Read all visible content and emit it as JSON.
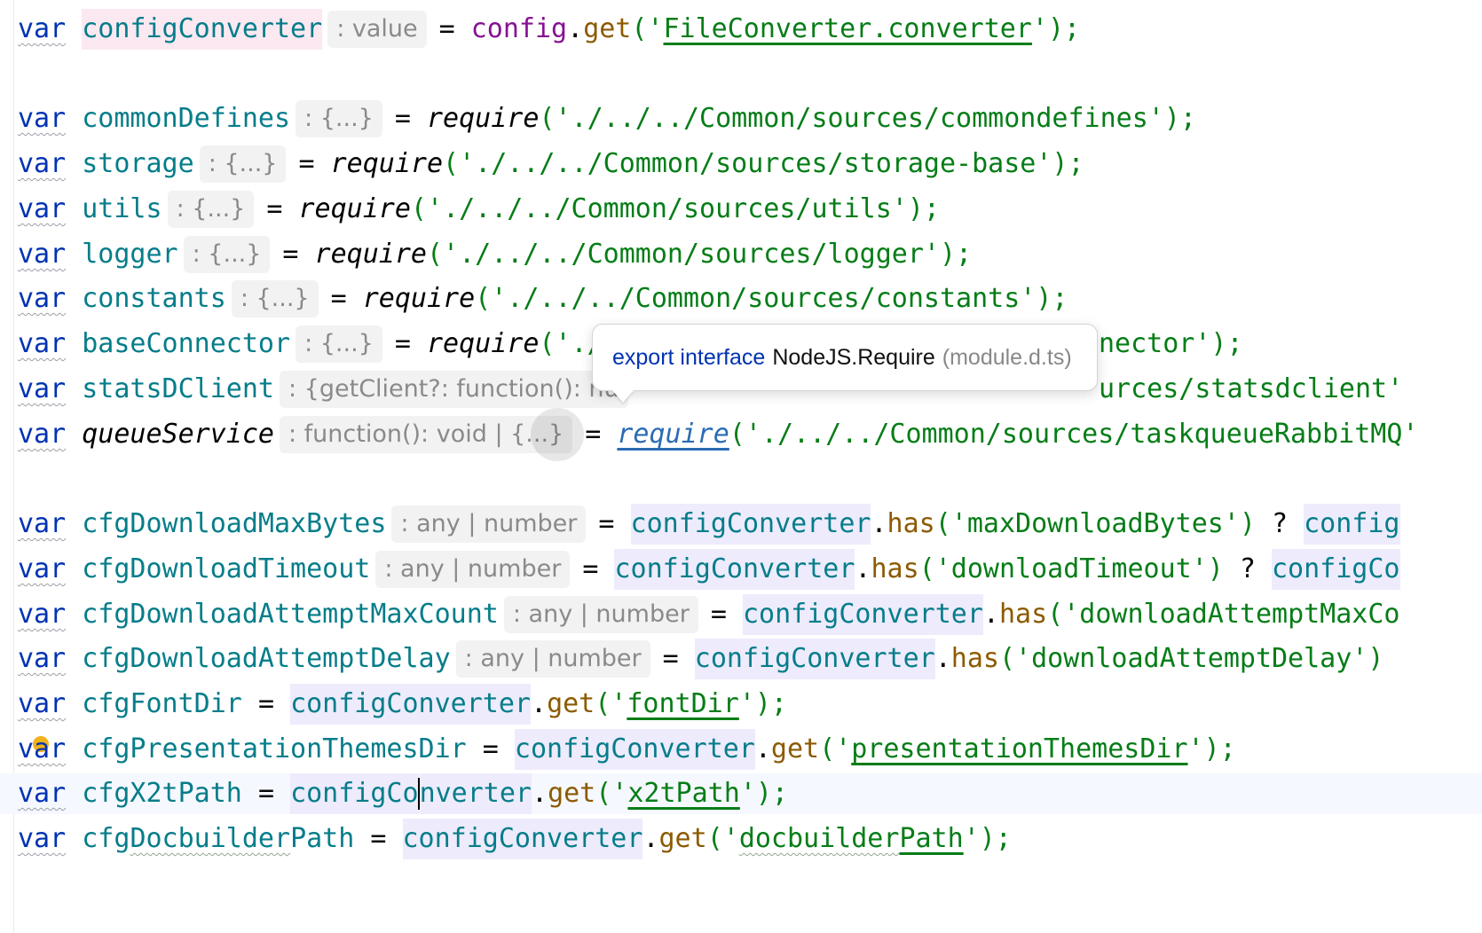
{
  "editor": {
    "lines": {
      "configConverter": {
        "kw": "var",
        "name": "configConverter",
        "hint": ": value",
        "eq": "=",
        "obj": "config",
        "dot": ".",
        "method": "get",
        "open": "('",
        "arg": "FileConverter.converter",
        "close": "');"
      },
      "commonDefines": {
        "kw": "var",
        "name": "commonDefines",
        "hint": ": {...}",
        "eq": "=",
        "fn": "require",
        "arg": "('./../../Common/sources/commondefines');"
      },
      "storage": {
        "kw": "var",
        "name": "storage",
        "hint": ": {...}",
        "eq": "=",
        "fn": "require",
        "arg": "('./../../Common/sources/storage-base');"
      },
      "utils": {
        "kw": "var",
        "name": "utils",
        "hint": ": {...}",
        "eq": "=",
        "fn": "require",
        "arg": "('./../../Common/sources/utils');"
      },
      "logger": {
        "kw": "var",
        "name": "logger",
        "hint": ": {...}",
        "eq": "=",
        "fn": "require",
        "arg": "('./../../Common/sources/logger');"
      },
      "constants": {
        "kw": "var",
        "name": "constants",
        "hint": ": {...}",
        "eq": "=",
        "fn": "require",
        "arg": "('./../../Common/sources/constants');"
      },
      "baseConnector": {
        "kw": "var",
        "name": "baseConnector",
        "hint": ": {...}",
        "eq": "=",
        "fn": "require",
        "arg": "('./",
        "tail": "nector');"
      },
      "statsDClient": {
        "kw": "var",
        "name": "statsDClient",
        "hint": ": {getClient?: function(): nu",
        "tail": "urces/statsdclient'"
      },
      "queueService": {
        "kw": "var",
        "name": "queueService",
        "hint": ": function(): void | {...}",
        "eq": "=",
        "fn": "require",
        "arg": "('./../../Common/sources/taskqueueRabbitMQ'"
      },
      "cfgDownloadMaxBytes": {
        "kw": "var",
        "name": "cfgDownloadMaxBytes",
        "hint": ": any | number",
        "eq": "=",
        "ref": "configConverter",
        "dot": ".",
        "method": "has",
        "arg": "('maxDownloadBytes')",
        "rest": " ? ",
        "ref2": "config"
      },
      "cfgDownloadTimeout": {
        "kw": "var",
        "name": "cfgDownloadTimeout",
        "hint": ": any | number",
        "eq": "=",
        "ref": "configConverter",
        "dot": ".",
        "method": "has",
        "arg": "('downloadTimeout')",
        "rest": " ? ",
        "ref2": "configCo"
      },
      "cfgDownloadAttemptMaxCount": {
        "kw": "var",
        "name": "cfgDownloadAttemptMaxCount",
        "hint": ": any | number",
        "eq": "=",
        "ref": "configConverter",
        "dot": ".",
        "method": "has",
        "arg": "('downloadAttemptMaxCo"
      },
      "cfgDownloadAttemptDelay": {
        "kw": "var",
        "name": "cfgDownloadAttemptDelay",
        "hint": ": any | number",
        "eq": "=",
        "ref": "configConverter",
        "dot": ".",
        "method": "has",
        "arg": "('downloadAttemptDelay')"
      },
      "cfgFontDir": {
        "kw": "var",
        "name": "cfgFontDir",
        "eq": "=",
        "ref": "configConverter",
        "dot": ".",
        "method": "get",
        "open": "('",
        "arg": "fontDir",
        "close": "');"
      },
      "cfgPresentationThemesDir": {
        "kw": "var",
        "name": "cfgPresentationThemesDir",
        "eq": "=",
        "ref": "configConverter",
        "dot": ".",
        "method": "get",
        "open": "('",
        "arg": "presentationThemesDir",
        "close": "');"
      },
      "cfgX2tPath": {
        "kw": "var",
        "name": "cfgX2tPath",
        "eq": "=",
        "ref_a": "configCo",
        "ref_b": "nverter",
        "dot": ".",
        "method": "get",
        "open": "('",
        "arg": "x2tPath",
        "close": "');"
      },
      "cfgDocbuilderPath": {
        "kw": "var",
        "name_a": "cfg",
        "name_b": "Docbuilder",
        "name_c": "Path",
        "eq": "=",
        "ref": "configConverter",
        "dot": ".",
        "method": "get",
        "open": "('",
        "arg_a": "docbuilder",
        "arg_b": "Path",
        "close": "');"
      }
    }
  },
  "tooltip": {
    "keyword": "export interface",
    "name": "NodeJS.Require",
    "source": "(module.d.ts)"
  },
  "colors": {
    "keyword": "#0033b3",
    "variable": "#067d8a",
    "string": "#067d17",
    "method": "#8c5a00",
    "reference_highlight": "#edebfc"
  },
  "icons": {
    "intention_bulb": "bulb-icon"
  }
}
